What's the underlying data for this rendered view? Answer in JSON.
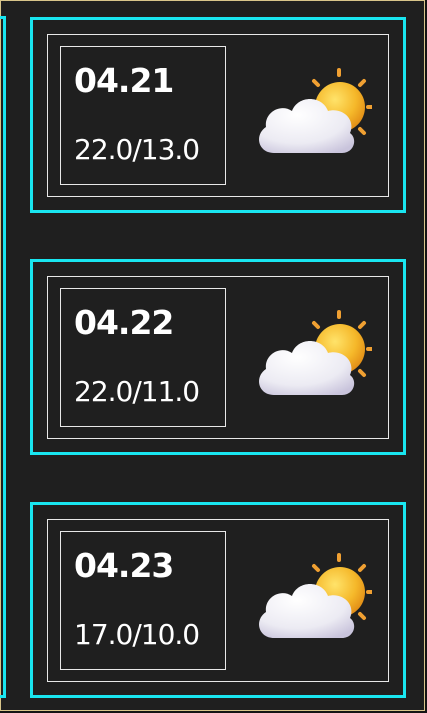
{
  "forecast": [
    {
      "date": "04.21",
      "temp": "22.0/13.0",
      "icon": "partly-cloudy-icon"
    },
    {
      "date": "04.22",
      "temp": "22.0/11.0",
      "icon": "partly-cloudy-icon"
    },
    {
      "date": "04.23",
      "temp": "17.0/10.0",
      "icon": "partly-cloudy-icon"
    }
  ],
  "colors": {
    "accent": "#19e6f0",
    "background": "#1f1f1f",
    "text": "#ffffff",
    "sun": "#f5b82a",
    "cloud": "#f2f0f8"
  }
}
